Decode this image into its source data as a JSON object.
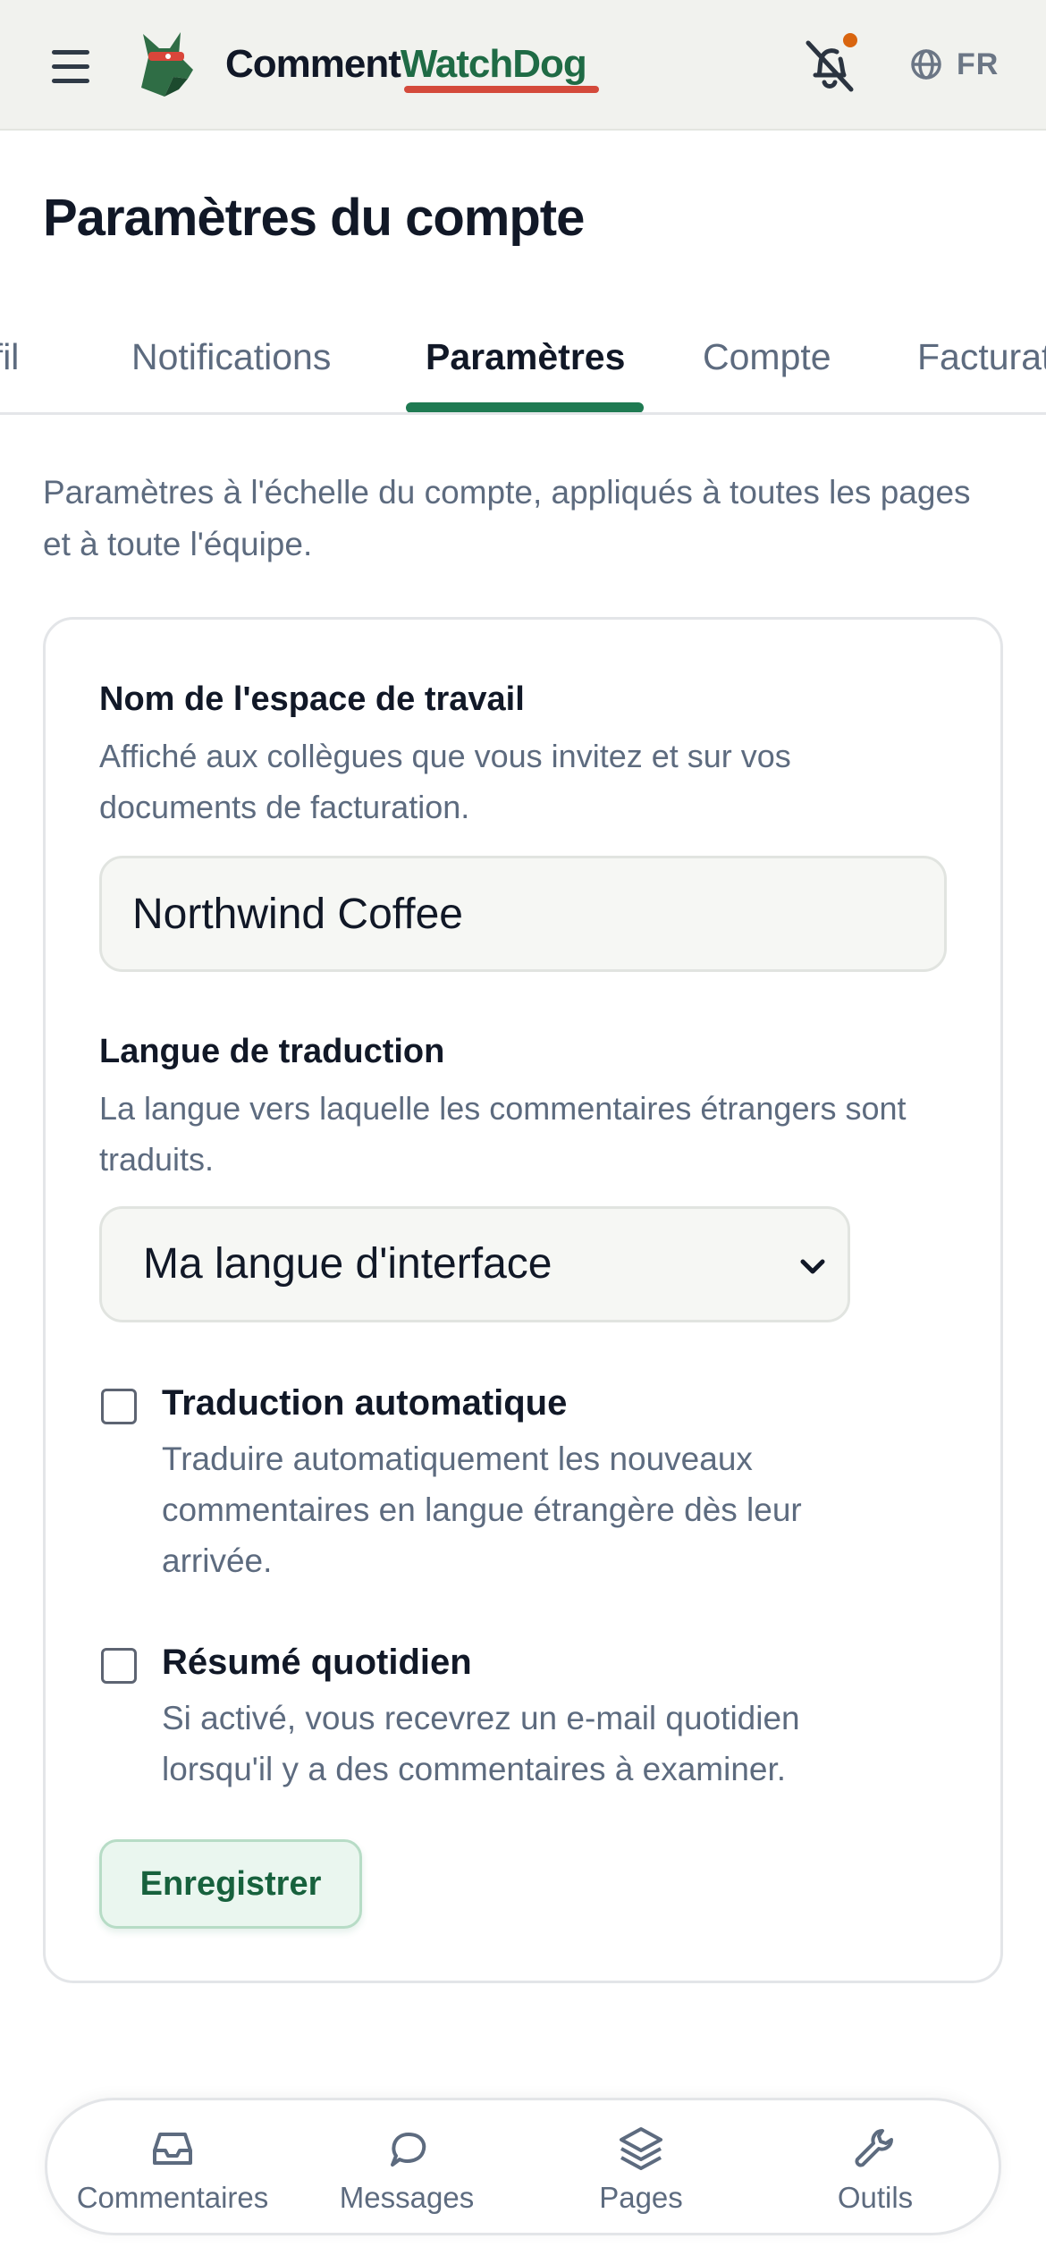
{
  "header": {
    "brand_part1": "Comment",
    "brand_part2": "WatchDog",
    "language_code": "FR",
    "icons": [
      "menu-icon",
      "watchdog-logo",
      "bell-off-icon",
      "globe-icon"
    ],
    "colors": {
      "brand_green": "#1f6b45",
      "underline_red": "#d44a3b",
      "notification_dot": "#d9650f"
    }
  },
  "page": {
    "title": "Paramètres du compte",
    "intro": "Paramètres à l'échelle du compte, appliqués à toutes les pages et à toute l'équipe."
  },
  "tabs": [
    {
      "label": "Profil"
    },
    {
      "label": "Notifications"
    },
    {
      "label": "Paramètres",
      "active": true
    },
    {
      "label": "Compte"
    },
    {
      "label": "Facturation"
    }
  ],
  "settings": {
    "workspace": {
      "label": "Nom de l'espace de travail",
      "help": "Affiché aux collègues que vous invitez et sur vos documents de facturation.",
      "value": "Northwind Coffee"
    },
    "translation_language": {
      "label": "Langue de traduction",
      "help": "La langue vers laquelle les commentaires étrangers sont traduits.",
      "selected": "Ma langue d'interface"
    },
    "auto_translate": {
      "label": "Traduction automatique",
      "help": "Traduire automatiquement les nouveaux commentaires en langue étrangère dès leur arrivée.",
      "checked": false
    },
    "daily_summary": {
      "label": "Résumé quotidien",
      "help": "Si activé, vous recevrez un e-mail quotidien lorsqu'il y a des commentaires à examiner.",
      "checked": false
    },
    "save_label": "Enregistrer"
  },
  "bottom_nav": [
    {
      "label": "Commentaires",
      "icon": "inbox-icon"
    },
    {
      "label": "Messages",
      "icon": "chat-bubble-icon"
    },
    {
      "label": "Pages",
      "icon": "layers-icon"
    },
    {
      "label": "Outils",
      "icon": "wrench-icon"
    }
  ]
}
